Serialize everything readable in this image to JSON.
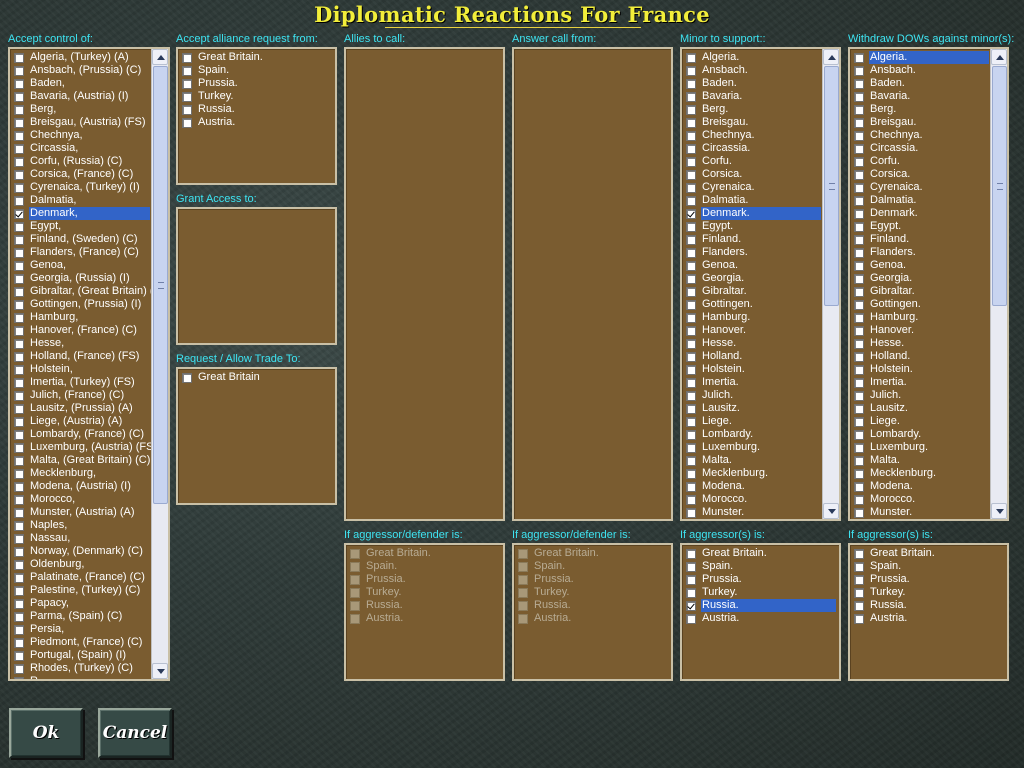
{
  "title": "Diplomatic Reactions For France",
  "labels": {
    "accept_control": "Accept control of:",
    "accept_alliance": "Accept alliance request from:",
    "grant_access": "Grant Access to:",
    "trade": "Request / Allow Trade To:",
    "allies_call": "Allies to call:",
    "answer_call": "Answer call from:",
    "minor_support": "Minor to support::",
    "withdraw": "Withdraw DOWs against minor(s):",
    "aggr_def_1": "If aggressor/defender is:",
    "aggr_def_2": "If aggressor/defender is:",
    "aggr_1": "If aggressor(s) is:",
    "aggr_2": "If aggressor(s) is:"
  },
  "accept_control": [
    {
      "t": "Algeria, (Turkey) (A)"
    },
    {
      "t": "Ansbach, (Prussia) (C)"
    },
    {
      "t": "Baden,"
    },
    {
      "t": "Bavaria, (Austria) (I)"
    },
    {
      "t": "Berg,"
    },
    {
      "t": "Breisgau, (Austria) (FS)"
    },
    {
      "t": "Chechnya,"
    },
    {
      "t": "Circassia,"
    },
    {
      "t": "Corfu, (Russia) (C)"
    },
    {
      "t": "Corsica, (France) (C)"
    },
    {
      "t": "Cyrenaica, (Turkey) (I)"
    },
    {
      "t": "Dalmatia,"
    },
    {
      "t": "Denmark,",
      "c": true,
      "s": true
    },
    {
      "t": "Egypt,"
    },
    {
      "t": "Finland, (Sweden) (C)"
    },
    {
      "t": "Flanders, (France) (C)"
    },
    {
      "t": "Genoa,"
    },
    {
      "t": "Georgia, (Russia) (I)"
    },
    {
      "t": "Gibraltar, (Great Britain) (C)"
    },
    {
      "t": "Gottingen, (Prussia) (I)"
    },
    {
      "t": "Hamburg,"
    },
    {
      "t": "Hanover, (France) (C)"
    },
    {
      "t": "Hesse,"
    },
    {
      "t": "Holland, (France) (FS)"
    },
    {
      "t": "Holstein,"
    },
    {
      "t": "Imertia, (Turkey) (FS)"
    },
    {
      "t": "Julich, (France) (C)"
    },
    {
      "t": "Lausitz, (Prussia) (A)"
    },
    {
      "t": "Liege, (Austria) (A)"
    },
    {
      "t": "Lombardy, (France) (C)"
    },
    {
      "t": "Luxemburg, (Austria) (FS)"
    },
    {
      "t": "Malta, (Great Britain) (C)"
    },
    {
      "t": "Mecklenburg,"
    },
    {
      "t": "Modena, (Austria) (I)"
    },
    {
      "t": "Morocco,"
    },
    {
      "t": "Munster, (Austria) (A)"
    },
    {
      "t": "Naples,"
    },
    {
      "t": "Nassau,"
    },
    {
      "t": "Norway, (Denmark) (C)"
    },
    {
      "t": "Oldenburg,"
    },
    {
      "t": "Palatinate, (France) (C)"
    },
    {
      "t": "Palestine, (Turkey) (C)"
    },
    {
      "t": "Papacy,"
    },
    {
      "t": "Parma, (Spain) (C)"
    },
    {
      "t": "Persia,"
    },
    {
      "t": "Piedmont, (France) (C)"
    },
    {
      "t": "Portugal, (Spain) (I)"
    },
    {
      "t": "Rhodes, (Turkey) (C)"
    },
    {
      "t": "R..."
    }
  ],
  "alliance": [
    {
      "t": "Great Britain."
    },
    {
      "t": "Spain."
    },
    {
      "t": "Prussia."
    },
    {
      "t": "Turkey."
    },
    {
      "t": "Russia."
    },
    {
      "t": "Austria."
    }
  ],
  "trade": [
    {
      "t": "Great Britain"
    }
  ],
  "minor_support": [
    {
      "t": "Algeria."
    },
    {
      "t": "Ansbach."
    },
    {
      "t": "Baden."
    },
    {
      "t": "Bavaria."
    },
    {
      "t": "Berg."
    },
    {
      "t": "Breisgau."
    },
    {
      "t": "Chechnya."
    },
    {
      "t": "Circassia."
    },
    {
      "t": "Corfu."
    },
    {
      "t": "Corsica."
    },
    {
      "t": "Cyrenaica."
    },
    {
      "t": "Dalmatia."
    },
    {
      "t": "Denmark.",
      "c": true,
      "s": true
    },
    {
      "t": "Egypt."
    },
    {
      "t": "Finland."
    },
    {
      "t": "Flanders."
    },
    {
      "t": "Genoa."
    },
    {
      "t": "Georgia."
    },
    {
      "t": "Gibraltar."
    },
    {
      "t": "Gottingen."
    },
    {
      "t": "Hamburg."
    },
    {
      "t": "Hanover."
    },
    {
      "t": "Hesse."
    },
    {
      "t": "Holland."
    },
    {
      "t": "Holstein."
    },
    {
      "t": "Imertia."
    },
    {
      "t": "Julich."
    },
    {
      "t": "Lausitz."
    },
    {
      "t": "Liege."
    },
    {
      "t": "Lombardy."
    },
    {
      "t": "Luxemburg."
    },
    {
      "t": "Malta."
    },
    {
      "t": "Mecklenburg."
    },
    {
      "t": "Modena."
    },
    {
      "t": "Morocco."
    },
    {
      "t": "Munster."
    }
  ],
  "withdraw": [
    {
      "t": "Algeria.",
      "s": true
    },
    {
      "t": "Ansbach."
    },
    {
      "t": "Baden."
    },
    {
      "t": "Bavaria."
    },
    {
      "t": "Berg."
    },
    {
      "t": "Breisgau."
    },
    {
      "t": "Chechnya."
    },
    {
      "t": "Circassia."
    },
    {
      "t": "Corfu."
    },
    {
      "t": "Corsica."
    },
    {
      "t": "Cyrenaica."
    },
    {
      "t": "Dalmatia."
    },
    {
      "t": "Denmark."
    },
    {
      "t": "Egypt."
    },
    {
      "t": "Finland."
    },
    {
      "t": "Flanders."
    },
    {
      "t": "Genoa."
    },
    {
      "t": "Georgia."
    },
    {
      "t": "Gibraltar."
    },
    {
      "t": "Gottingen."
    },
    {
      "t": "Hamburg."
    },
    {
      "t": "Hanover."
    },
    {
      "t": "Hesse."
    },
    {
      "t": "Holland."
    },
    {
      "t": "Holstein."
    },
    {
      "t": "Imertia."
    },
    {
      "t": "Julich."
    },
    {
      "t": "Lausitz."
    },
    {
      "t": "Liege."
    },
    {
      "t": "Lombardy."
    },
    {
      "t": "Luxemburg."
    },
    {
      "t": "Malta."
    },
    {
      "t": "Mecklenburg."
    },
    {
      "t": "Modena."
    },
    {
      "t": "Morocco."
    },
    {
      "t": "Munster."
    }
  ],
  "aggr_def_1": [
    {
      "t": "Great Britain.",
      "d": true
    },
    {
      "t": "Spain.",
      "d": true
    },
    {
      "t": "Prussia.",
      "d": true
    },
    {
      "t": "Turkey.",
      "d": true
    },
    {
      "t": "Russia.",
      "d": true
    },
    {
      "t": "Austria.",
      "d": true
    }
  ],
  "aggr_def_2": [
    {
      "t": "Great Britain.",
      "d": true
    },
    {
      "t": "Spain.",
      "d": true
    },
    {
      "t": "Prussia.",
      "d": true
    },
    {
      "t": "Turkey.",
      "d": true
    },
    {
      "t": "Russia.",
      "d": true
    },
    {
      "t": "Austria.",
      "d": true
    }
  ],
  "aggr_1": [
    {
      "t": "Great Britain."
    },
    {
      "t": "Spain."
    },
    {
      "t": "Prussia."
    },
    {
      "t": "Turkey."
    },
    {
      "t": "Russia.",
      "c": true,
      "s": true
    },
    {
      "t": "Austria."
    }
  ],
  "aggr_2": [
    {
      "t": "Great Britain."
    },
    {
      "t": "Spain."
    },
    {
      "t": "Prussia."
    },
    {
      "t": "Turkey."
    },
    {
      "t": "Russia."
    },
    {
      "t": "Austria."
    }
  ],
  "buttons": {
    "ok": "Ok",
    "cancel": "Cancel"
  },
  "colors": {
    "panel": "#7a5c30",
    "label": "#3ee4f2",
    "title": "#f2ee3a",
    "selection": "#3264c8"
  }
}
